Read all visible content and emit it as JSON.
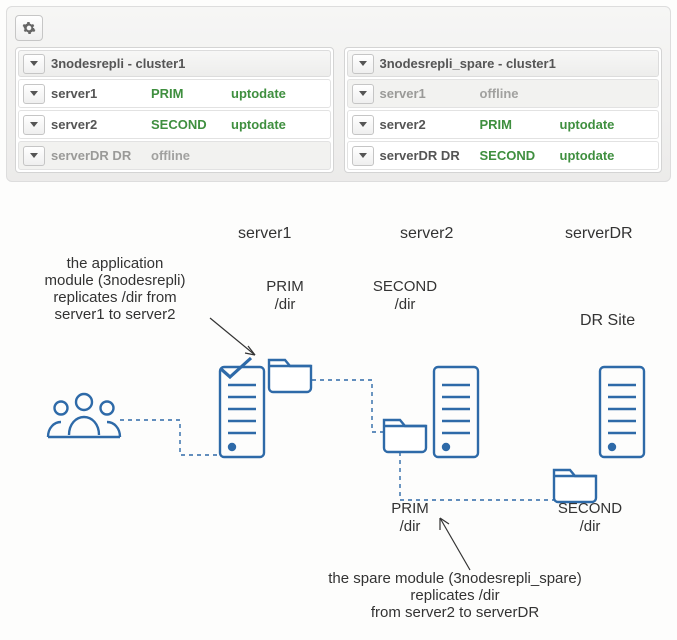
{
  "panelLeft": {
    "title": "3nodesrepli - cluster1",
    "rows": [
      {
        "name": "server1",
        "role": "PRIM",
        "sync": "uptodate",
        "offline": false
      },
      {
        "name": "server2",
        "role": "SECOND",
        "sync": "uptodate",
        "offline": false
      },
      {
        "name": "serverDR DR",
        "role": "offline",
        "sync": "",
        "offline": true
      }
    ]
  },
  "panelRight": {
    "title": "3nodesrepli_spare - cluster1",
    "rows": [
      {
        "name": "server1",
        "role": "offline",
        "sync": "",
        "offline": true
      },
      {
        "name": "server2",
        "role": "PRIM",
        "sync": "uptodate",
        "offline": false
      },
      {
        "name": "serverDR DR",
        "role": "SECOND",
        "sync": "uptodate",
        "offline": false
      }
    ]
  },
  "diagram": {
    "topLabels": {
      "server1": "server1",
      "server2": "server2",
      "serverDR": "serverDR"
    },
    "drSite": "DR Site",
    "pair1": {
      "role": "PRIM",
      "dir": "/dir"
    },
    "pair2": {
      "role": "SECOND",
      "dir": "/dir"
    },
    "pair3": {
      "role": "PRIM",
      "dir": "/dir"
    },
    "pair4": {
      "role": "SECOND",
      "dir": "/dir"
    },
    "annotationLeft": "the application\nmodule (3nodesrepli)\nreplicates /dir from\nserver1 to server2",
    "annotationBottom": "the spare module (3nodesrepli_spare)\nreplicates /dir\nfrom server2 to serverDR"
  },
  "icons": {
    "gear": "gear-icon",
    "users": "users-icon",
    "server": "server-icon",
    "folder": "folder-icon",
    "check": "check-icon"
  },
  "colors": {
    "green": "#3f8f3f",
    "grey": "#9a9a98",
    "blue": "#2e6aa8",
    "dash": "#2e6aa8"
  }
}
